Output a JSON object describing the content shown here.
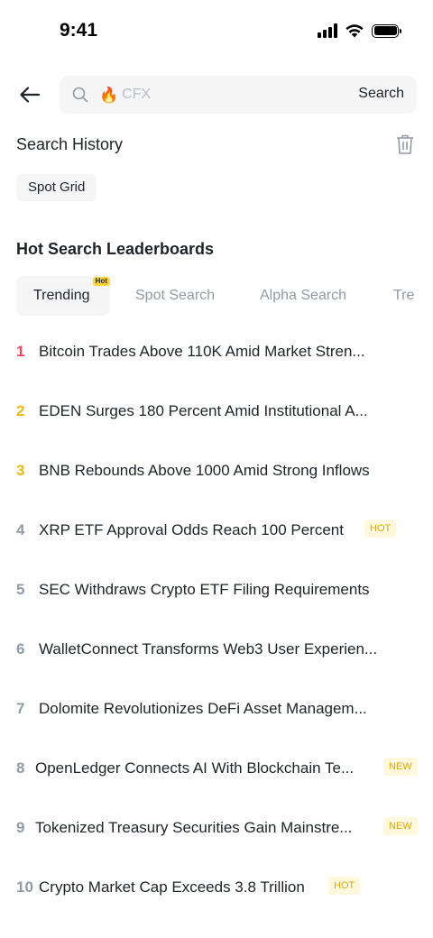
{
  "status": {
    "time": "9:41"
  },
  "search": {
    "placeholder": "CFX",
    "prefix_icon": "fire",
    "submit_label": "Search"
  },
  "history": {
    "title": "Search History",
    "items": [
      "Spot Grid"
    ]
  },
  "leaderboards": {
    "title": "Hot Search Leaderboards",
    "tabs": [
      {
        "label": "Trending",
        "badge": "Hot",
        "active": true
      },
      {
        "label": "Spot Search"
      },
      {
        "label": "Alpha Search"
      },
      {
        "label": "Tre"
      }
    ],
    "items": [
      {
        "rank": "1",
        "text": "Bitcoin Trades Above 110K Amid Market Stren...",
        "tag": ""
      },
      {
        "rank": "2",
        "text": "EDEN Surges 180 Percent Amid Institutional A...",
        "tag": ""
      },
      {
        "rank": "3",
        "text": "BNB Rebounds Above 1000 Amid Strong Inflows",
        "tag": ""
      },
      {
        "rank": "4",
        "text": "XRP ETF Approval Odds Reach 100 Percent",
        "tag": "HOT"
      },
      {
        "rank": "5",
        "text": "SEC Withdraws Crypto ETF Filing Requirements",
        "tag": ""
      },
      {
        "rank": "6",
        "text": "WalletConnect Transforms Web3 User Experien...",
        "tag": ""
      },
      {
        "rank": "7",
        "text": "Dolomite Revolutionizes DeFi Asset Managem...",
        "tag": ""
      },
      {
        "rank": "8",
        "text": "OpenLedger Connects AI With Blockchain Te...",
        "tag": "NEW"
      },
      {
        "rank": "9",
        "text": "Tokenized Treasury Securities Gain Mainstre...",
        "tag": "NEW"
      },
      {
        "rank": "10",
        "text": "Crypto Market Cap Exceeds 3.8 Trillion",
        "tag": "HOT"
      }
    ]
  },
  "colors": {
    "rank_1": "#f6465d",
    "rank_2_3": "#f0b90b",
    "rank_other": "#929aa5",
    "tag_text": "#d9a80c",
    "tag_bg": "#fff8dc"
  }
}
